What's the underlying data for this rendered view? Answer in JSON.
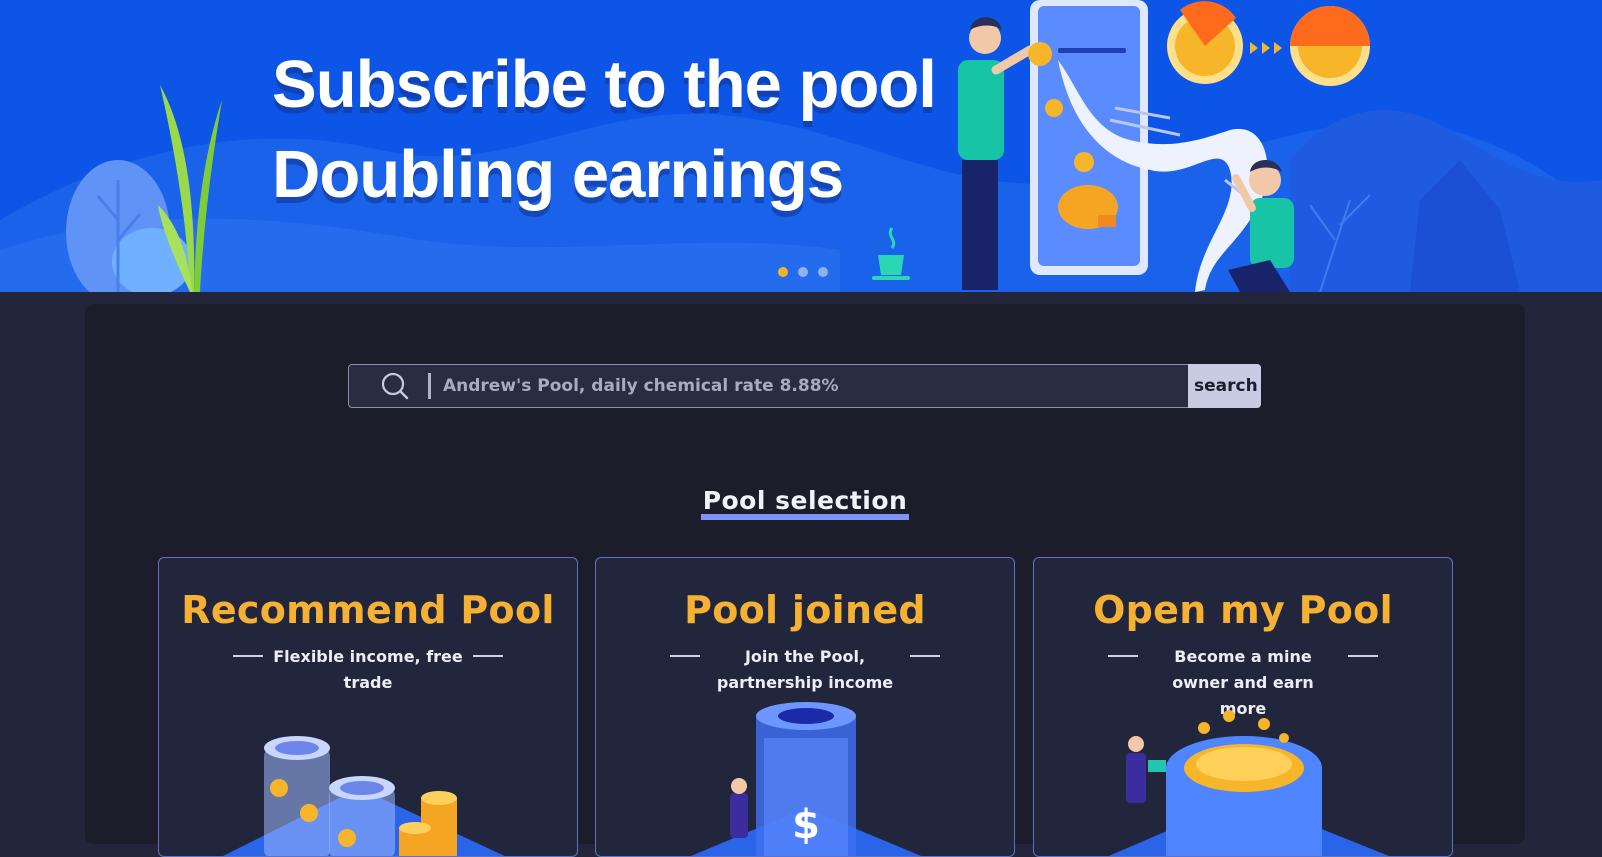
{
  "banner": {
    "title_line1": "Subscribe to the pool",
    "title_line2": "Doubling earnings",
    "carousel": {
      "slides": 3,
      "active": 0
    }
  },
  "search": {
    "placeholder": "Andrew's Pool, daily chemical rate 8.88%",
    "button_label": "search",
    "icon": "search-icon"
  },
  "section": {
    "title": "Pool selection"
  },
  "cards": [
    {
      "title": "Recommend Pool",
      "subtitle": "Flexible income, free trade",
      "icon": "coin-cylinders-illustration"
    },
    {
      "title": "Pool joined",
      "subtitle": "Join the Pool, partnership income",
      "icon": "dollar-tower-illustration"
    },
    {
      "title": "Open my Pool",
      "subtitle": "Become a mine owner and earn more",
      "icon": "coin-pool-illustration"
    }
  ],
  "colors": {
    "banner_bg": "#0c55e6",
    "page_bg": "#23263a",
    "panel_bg": "#1b1d2b",
    "accent_gold": "#f6b132",
    "underline": "#7f95f5",
    "card_border": "#5e72c8"
  }
}
